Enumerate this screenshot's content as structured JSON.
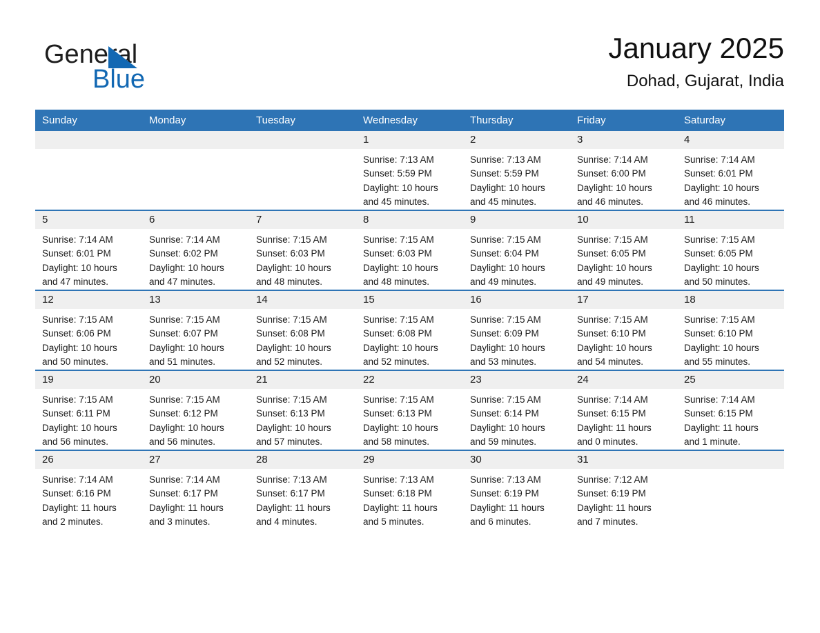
{
  "brand": {
    "name_part1": "General",
    "name_part2": "Blue",
    "logo_icon": "triangle-logo-icon",
    "accent_color": "#1268b3"
  },
  "header": {
    "title": "January 2025",
    "location": "Dohad, Gujarat, India"
  },
  "calendar": {
    "header_bg": "#2e74b5",
    "row_divider_color": "#2e74b5",
    "daynum_strip_bg": "#efefef",
    "weekday_headers": [
      "Sunday",
      "Monday",
      "Tuesday",
      "Wednesday",
      "Thursday",
      "Friday",
      "Saturday"
    ],
    "weeks": [
      [
        {
          "day": "",
          "lines": []
        },
        {
          "day": "",
          "lines": []
        },
        {
          "day": "",
          "lines": []
        },
        {
          "day": "1",
          "lines": [
            "Sunrise: 7:13 AM",
            "Sunset: 5:59 PM",
            "Daylight: 10 hours",
            "and 45 minutes."
          ]
        },
        {
          "day": "2",
          "lines": [
            "Sunrise: 7:13 AM",
            "Sunset: 5:59 PM",
            "Daylight: 10 hours",
            "and 45 minutes."
          ]
        },
        {
          "day": "3",
          "lines": [
            "Sunrise: 7:14 AM",
            "Sunset: 6:00 PM",
            "Daylight: 10 hours",
            "and 46 minutes."
          ]
        },
        {
          "day": "4",
          "lines": [
            "Sunrise: 7:14 AM",
            "Sunset: 6:01 PM",
            "Daylight: 10 hours",
            "and 46 minutes."
          ]
        }
      ],
      [
        {
          "day": "5",
          "lines": [
            "Sunrise: 7:14 AM",
            "Sunset: 6:01 PM",
            "Daylight: 10 hours",
            "and 47 minutes."
          ]
        },
        {
          "day": "6",
          "lines": [
            "Sunrise: 7:14 AM",
            "Sunset: 6:02 PM",
            "Daylight: 10 hours",
            "and 47 minutes."
          ]
        },
        {
          "day": "7",
          "lines": [
            "Sunrise: 7:15 AM",
            "Sunset: 6:03 PM",
            "Daylight: 10 hours",
            "and 48 minutes."
          ]
        },
        {
          "day": "8",
          "lines": [
            "Sunrise: 7:15 AM",
            "Sunset: 6:03 PM",
            "Daylight: 10 hours",
            "and 48 minutes."
          ]
        },
        {
          "day": "9",
          "lines": [
            "Sunrise: 7:15 AM",
            "Sunset: 6:04 PM",
            "Daylight: 10 hours",
            "and 49 minutes."
          ]
        },
        {
          "day": "10",
          "lines": [
            "Sunrise: 7:15 AM",
            "Sunset: 6:05 PM",
            "Daylight: 10 hours",
            "and 49 minutes."
          ]
        },
        {
          "day": "11",
          "lines": [
            "Sunrise: 7:15 AM",
            "Sunset: 6:05 PM",
            "Daylight: 10 hours",
            "and 50 minutes."
          ]
        }
      ],
      [
        {
          "day": "12",
          "lines": [
            "Sunrise: 7:15 AM",
            "Sunset: 6:06 PM",
            "Daylight: 10 hours",
            "and 50 minutes."
          ]
        },
        {
          "day": "13",
          "lines": [
            "Sunrise: 7:15 AM",
            "Sunset: 6:07 PM",
            "Daylight: 10 hours",
            "and 51 minutes."
          ]
        },
        {
          "day": "14",
          "lines": [
            "Sunrise: 7:15 AM",
            "Sunset: 6:08 PM",
            "Daylight: 10 hours",
            "and 52 minutes."
          ]
        },
        {
          "day": "15",
          "lines": [
            "Sunrise: 7:15 AM",
            "Sunset: 6:08 PM",
            "Daylight: 10 hours",
            "and 52 minutes."
          ]
        },
        {
          "day": "16",
          "lines": [
            "Sunrise: 7:15 AM",
            "Sunset: 6:09 PM",
            "Daylight: 10 hours",
            "and 53 minutes."
          ]
        },
        {
          "day": "17",
          "lines": [
            "Sunrise: 7:15 AM",
            "Sunset: 6:10 PM",
            "Daylight: 10 hours",
            "and 54 minutes."
          ]
        },
        {
          "day": "18",
          "lines": [
            "Sunrise: 7:15 AM",
            "Sunset: 6:10 PM",
            "Daylight: 10 hours",
            "and 55 minutes."
          ]
        }
      ],
      [
        {
          "day": "19",
          "lines": [
            "Sunrise: 7:15 AM",
            "Sunset: 6:11 PM",
            "Daylight: 10 hours",
            "and 56 minutes."
          ]
        },
        {
          "day": "20",
          "lines": [
            "Sunrise: 7:15 AM",
            "Sunset: 6:12 PM",
            "Daylight: 10 hours",
            "and 56 minutes."
          ]
        },
        {
          "day": "21",
          "lines": [
            "Sunrise: 7:15 AM",
            "Sunset: 6:13 PM",
            "Daylight: 10 hours",
            "and 57 minutes."
          ]
        },
        {
          "day": "22",
          "lines": [
            "Sunrise: 7:15 AM",
            "Sunset: 6:13 PM",
            "Daylight: 10 hours",
            "and 58 minutes."
          ]
        },
        {
          "day": "23",
          "lines": [
            "Sunrise: 7:15 AM",
            "Sunset: 6:14 PM",
            "Daylight: 10 hours",
            "and 59 minutes."
          ]
        },
        {
          "day": "24",
          "lines": [
            "Sunrise: 7:14 AM",
            "Sunset: 6:15 PM",
            "Daylight: 11 hours",
            "and 0 minutes."
          ]
        },
        {
          "day": "25",
          "lines": [
            "Sunrise: 7:14 AM",
            "Sunset: 6:15 PM",
            "Daylight: 11 hours",
            "and 1 minute."
          ]
        }
      ],
      [
        {
          "day": "26",
          "lines": [
            "Sunrise: 7:14 AM",
            "Sunset: 6:16 PM",
            "Daylight: 11 hours",
            "and 2 minutes."
          ]
        },
        {
          "day": "27",
          "lines": [
            "Sunrise: 7:14 AM",
            "Sunset: 6:17 PM",
            "Daylight: 11 hours",
            "and 3 minutes."
          ]
        },
        {
          "day": "28",
          "lines": [
            "Sunrise: 7:13 AM",
            "Sunset: 6:17 PM",
            "Daylight: 11 hours",
            "and 4 minutes."
          ]
        },
        {
          "day": "29",
          "lines": [
            "Sunrise: 7:13 AM",
            "Sunset: 6:18 PM",
            "Daylight: 11 hours",
            "and 5 minutes."
          ]
        },
        {
          "day": "30",
          "lines": [
            "Sunrise: 7:13 AM",
            "Sunset: 6:19 PM",
            "Daylight: 11 hours",
            "and 6 minutes."
          ]
        },
        {
          "day": "31",
          "lines": [
            "Sunrise: 7:12 AM",
            "Sunset: 6:19 PM",
            "Daylight: 11 hours",
            "and 7 minutes."
          ]
        },
        {
          "day": "",
          "lines": []
        }
      ]
    ]
  }
}
